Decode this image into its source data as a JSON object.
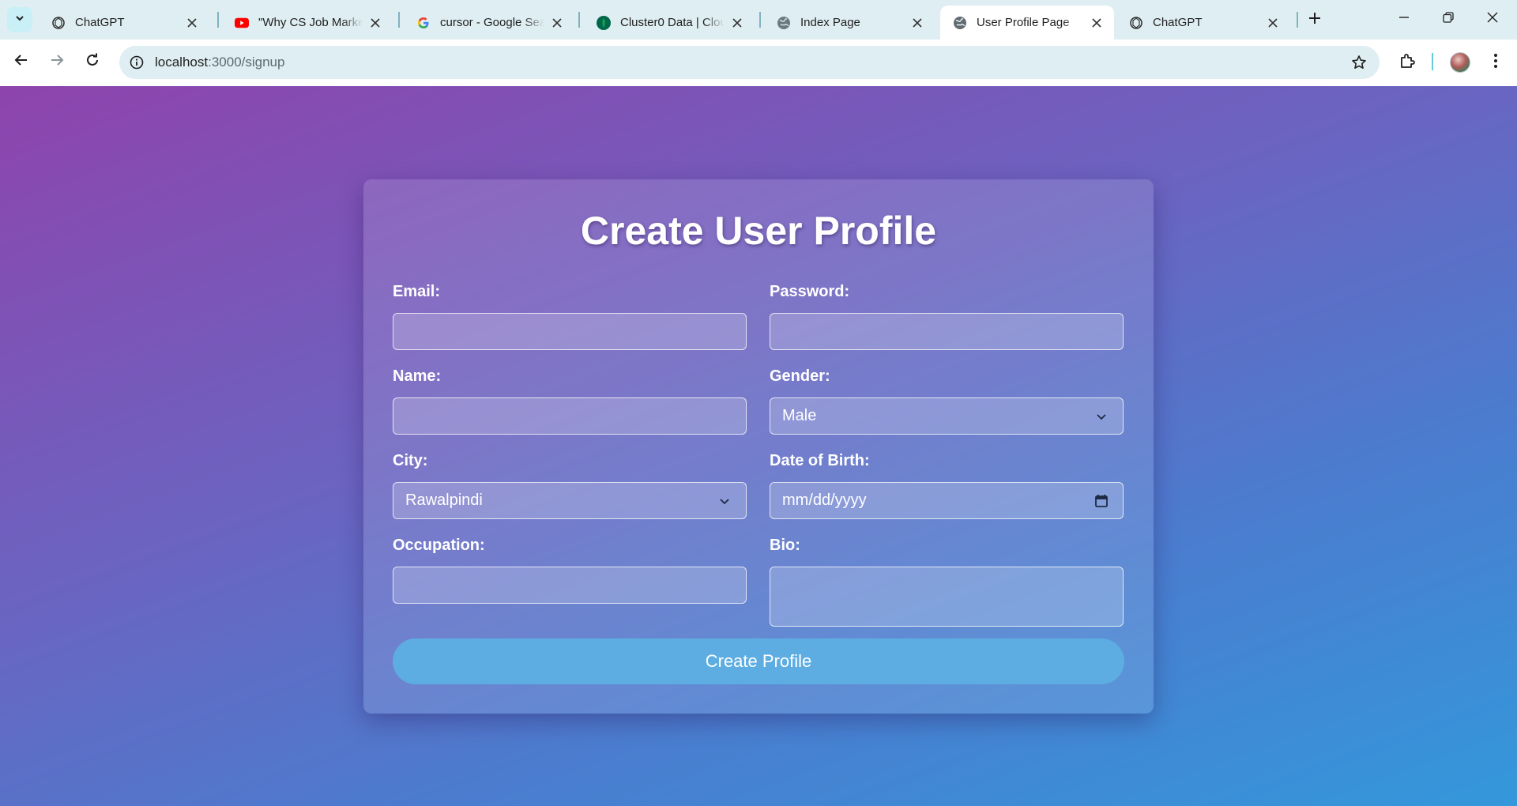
{
  "browser": {
    "tabs": [
      {
        "title": "ChatGPT",
        "icon": "chatgpt-icon",
        "active": false
      },
      {
        "title": "\"Why CS Job Market",
        "icon": "youtube-icon",
        "active": false
      },
      {
        "title": "cursor - Google Search",
        "icon": "google-icon",
        "active": false
      },
      {
        "title": "Cluster0 Data | Cloud",
        "icon": "mongodb-icon",
        "active": false
      },
      {
        "title": "Index Page",
        "icon": "globe-icon",
        "active": false
      },
      {
        "title": "User Profile Page",
        "icon": "globe-icon",
        "active": true
      },
      {
        "title": "ChatGPT",
        "icon": "chatgpt-icon",
        "active": false
      }
    ],
    "url": {
      "host": "localhost",
      "path": ":3000/signup"
    }
  },
  "form": {
    "title": "Create User Profile",
    "fields": {
      "email": {
        "label": "Email:",
        "value": ""
      },
      "password": {
        "label": "Password:",
        "value": ""
      },
      "name": {
        "label": "Name:",
        "value": ""
      },
      "gender": {
        "label": "Gender:",
        "value": "Male"
      },
      "city": {
        "label": "City:",
        "value": "Rawalpindi"
      },
      "dob": {
        "label": "Date of Birth:",
        "value": "mm/dd/yyyy"
      },
      "occupation": {
        "label": "Occupation:",
        "value": ""
      },
      "bio": {
        "label": "Bio:",
        "value": ""
      }
    },
    "submit_label": "Create Profile"
  },
  "colors": {
    "gradient_start": "#8e44ad",
    "gradient_end": "#3498db",
    "button": "#5dade2",
    "youtube": "#ff0000",
    "mongodb": "#00684a"
  }
}
